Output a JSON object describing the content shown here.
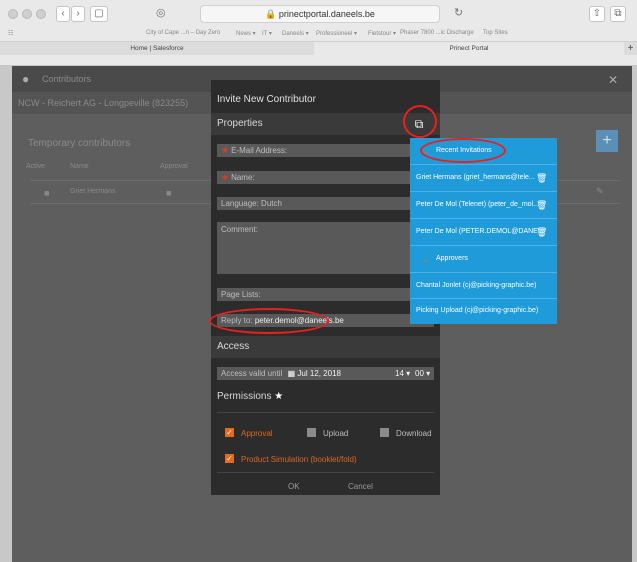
{
  "browser": {
    "url": "prinectportal.daneels.be",
    "favorites": [
      "City of Cape ...n – Day Zero",
      "News ▾",
      "IT ▾",
      "Daneels ▾",
      "Professioneel ▾",
      "Fietstour ▾",
      "Phaser 7800 ...ic Discharge",
      "Top Sites"
    ],
    "tabs": [
      "Home | Salesforce",
      "Prinect Portal"
    ]
  },
  "background_app": {
    "header": "Contributors",
    "subheader": "NCW - Reichert AG - Longpeville (823255)",
    "section": "Temporary contributors",
    "col_active": "Active",
    "col_name": "Name",
    "col_approval": "Approval",
    "row_name": "Griet Hermans"
  },
  "modal": {
    "title": "Invite New Contributor",
    "properties_label": "Properties",
    "email_placeholder": "E-Mail Address:",
    "name_placeholder": "Name:",
    "language_value": "Language: Dutch",
    "comment_placeholder": "Comment:",
    "page_lists_placeholder": "Page Lists:",
    "reply_to_label": "Reply to:",
    "reply_to_value": "peter.demol@daneels.be",
    "access_label": "Access",
    "access_valid_label": "Access valid until",
    "access_date": "Jul 12, 2018",
    "access_hour": "14 ▾",
    "access_minute": "00 ▾",
    "permissions_label": "Permissions",
    "permissions_star": "★",
    "perm_approval": "Approval",
    "perm_upload": "Upload",
    "perm_download": "Download",
    "perm_product_simulation": "Product Simulation (booklet/fold)",
    "ok_label": "OK",
    "cancel_label": "Cancel"
  },
  "dropdown": {
    "recent_header": "Recent Invitations",
    "recent": [
      "Griet Hermans (griet_hermans@tele...",
      "Peter De Mol (Telenet) (peter_de_mol...",
      "Peter De Mol (PETER.DEMOL@DANE..."
    ],
    "approvers_header": "Approvers",
    "approvers": [
      "Chantal Jonlet (cj@picking-graphic.be)",
      "Picking Upload (cj@picking-graphic.be)"
    ]
  }
}
